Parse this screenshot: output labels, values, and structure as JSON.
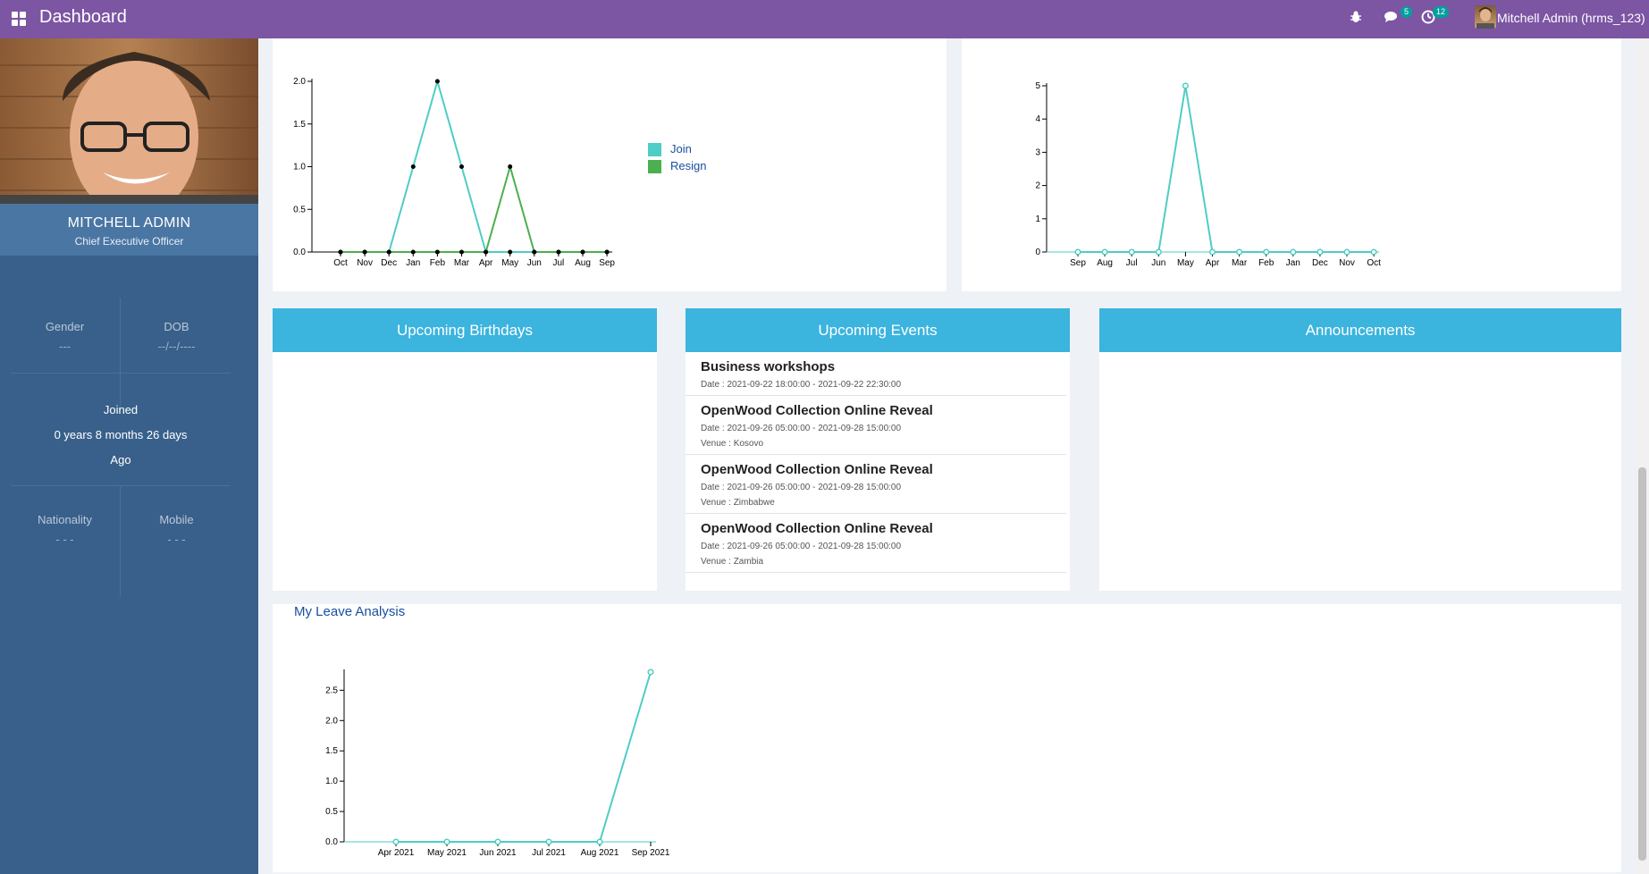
{
  "topbar": {
    "title": "Dashboard",
    "chat_badge": "5",
    "activity_badge": "12",
    "user_name": "Mitchell Admin (hrms_123)"
  },
  "sidebar": {
    "name": "MITCHELL ADMIN",
    "role": "Chief Executive Officer",
    "gender_label": "Gender",
    "gender_value": "---",
    "dob_label": "DOB",
    "dob_value": "--/--/----",
    "joined_label": "Joined",
    "joined_value": "0 years 8 months 26 days",
    "joined_suffix": "Ago",
    "nationality_label": "Nationality",
    "nationality_value": "- - -",
    "mobile_label": "Mobile",
    "mobile_value": "- - -"
  },
  "birthdays": {
    "title": "Upcoming Birthdays"
  },
  "events": {
    "title": "Upcoming Events",
    "items": [
      {
        "title": "Business workshops",
        "date": "Date : 2021-09-22 18:00:00 - 2021-09-22 22:30:00",
        "venue": ""
      },
      {
        "title": "OpenWood Collection Online Reveal",
        "date": "Date : 2021-09-26 05:00:00 - 2021-09-28 15:00:00",
        "venue": "Venue : Kosovo"
      },
      {
        "title": "OpenWood Collection Online Reveal",
        "date": "Date : 2021-09-26 05:00:00 - 2021-09-28 15:00:00",
        "venue": "Venue : Zimbabwe"
      },
      {
        "title": "OpenWood Collection Online Reveal",
        "date": "Date : 2021-09-26 05:00:00 - 2021-09-28 15:00:00",
        "venue": "Venue : Zambia"
      }
    ]
  },
  "announcements": {
    "title": "Announcements"
  },
  "leave_analysis": {
    "title": "My Leave Analysis"
  },
  "colors": {
    "topbar": "#7c55a3",
    "sidebar": "#38608a",
    "card_header": "#3bb4de",
    "join": "#4ecdc4",
    "resign": "#4caf50"
  },
  "chart_data": [
    {
      "type": "line",
      "categories": [
        "Oct",
        "Nov",
        "Dec",
        "Jan",
        "Feb",
        "Mar",
        "Apr",
        "May",
        "Jun",
        "Jul",
        "Aug",
        "Sep"
      ],
      "series": [
        {
          "name": "Join",
          "values": [
            0,
            0,
            0,
            1,
            2,
            1,
            0,
            0,
            0,
            0,
            0,
            0
          ]
        },
        {
          "name": "Resign",
          "values": [
            0,
            0,
            0,
            0,
            0,
            0,
            0,
            1,
            0,
            0,
            0,
            0
          ]
        }
      ],
      "yticks": [
        "0.0",
        "0.5",
        "1.0",
        "1.5",
        "2.0"
      ],
      "ylim": [
        0,
        2
      ],
      "legend": "right"
    },
    {
      "type": "line",
      "categories": [
        "Sep",
        "Aug",
        "Jul",
        "Jun",
        "May",
        "Apr",
        "Mar",
        "Feb",
        "Jan",
        "Dec",
        "Nov",
        "Oct"
      ],
      "series": [
        {
          "values": [
            0,
            0,
            0,
            0,
            5,
            0,
            0,
            0,
            0,
            0,
            0,
            0
          ]
        }
      ],
      "yticks": [
        "0",
        "1",
        "2",
        "3",
        "4",
        "5"
      ],
      "ylim": [
        0,
        5
      ]
    },
    {
      "type": "line",
      "title": "My Leave Analysis",
      "categories": [
        "Apr 2021",
        "May 2021",
        "Jun 2021",
        "Jul 2021",
        "Aug 2021",
        "Sep 2021"
      ],
      "series": [
        {
          "values": [
            0,
            0,
            0,
            0,
            0,
            2.8
          ]
        }
      ],
      "yticks": [
        "0.0",
        "0.5",
        "1.0",
        "1.5",
        "2.0",
        "2.5"
      ],
      "ylim": [
        0,
        2.8
      ]
    }
  ]
}
